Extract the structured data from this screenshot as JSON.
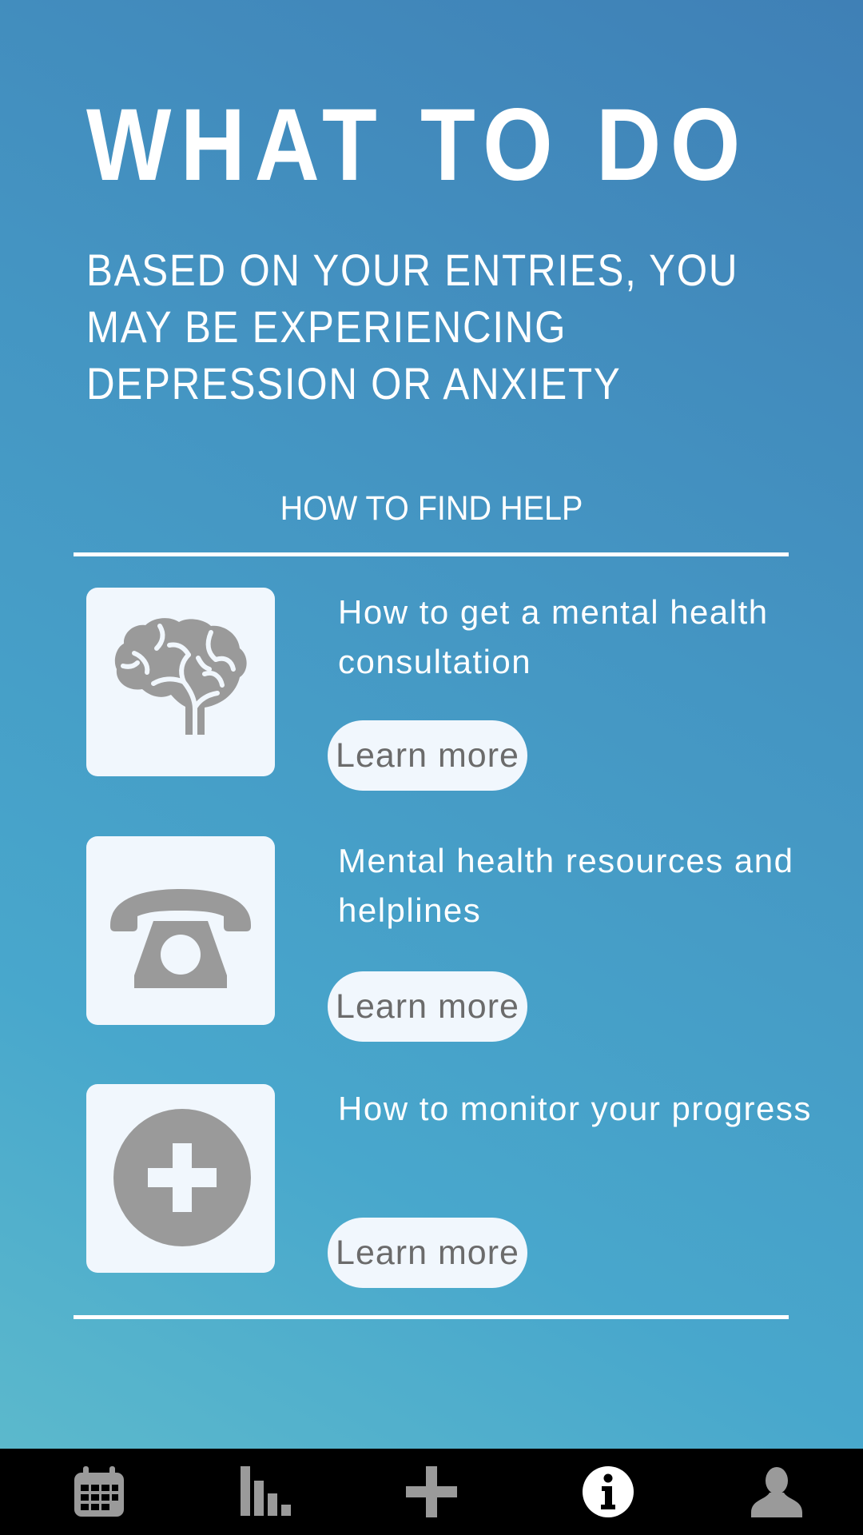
{
  "header": {
    "title": "WHAT TO DO",
    "subtitle": "BASED ON YOUR ENTRIES, YOU MAY BE EXPERIENCING DEPRESSION OR ANXIETY"
  },
  "help_section": {
    "heading": "HOW TO FIND HELP",
    "items": [
      {
        "icon": "brain-icon",
        "text": "How to get a mental health consultation",
        "button_label": "Learn more"
      },
      {
        "icon": "telephone-icon",
        "text": "Mental health resources and helplines",
        "button_label": "Learn more"
      },
      {
        "icon": "plus-circle-icon",
        "text": "How to monitor your progress",
        "button_label": "Learn more"
      }
    ]
  },
  "tab_bar": {
    "tabs": [
      {
        "icon": "calendar-icon",
        "active": false
      },
      {
        "icon": "bar-chart-icon",
        "active": false
      },
      {
        "icon": "plus-icon",
        "active": false
      },
      {
        "icon": "info-icon",
        "active": true
      },
      {
        "icon": "user-icon",
        "active": false
      }
    ]
  },
  "colors": {
    "background_top": "#3f80b6",
    "background_bottom": "#5fbccc",
    "tile_background": "#f1f7fd",
    "icon_gray": "#9a9a9a",
    "button_text": "#6b6b6b",
    "tab_bar": "#000000",
    "tab_icon_inactive": "#9a9a9a",
    "tab_icon_active": "#ffffff"
  }
}
